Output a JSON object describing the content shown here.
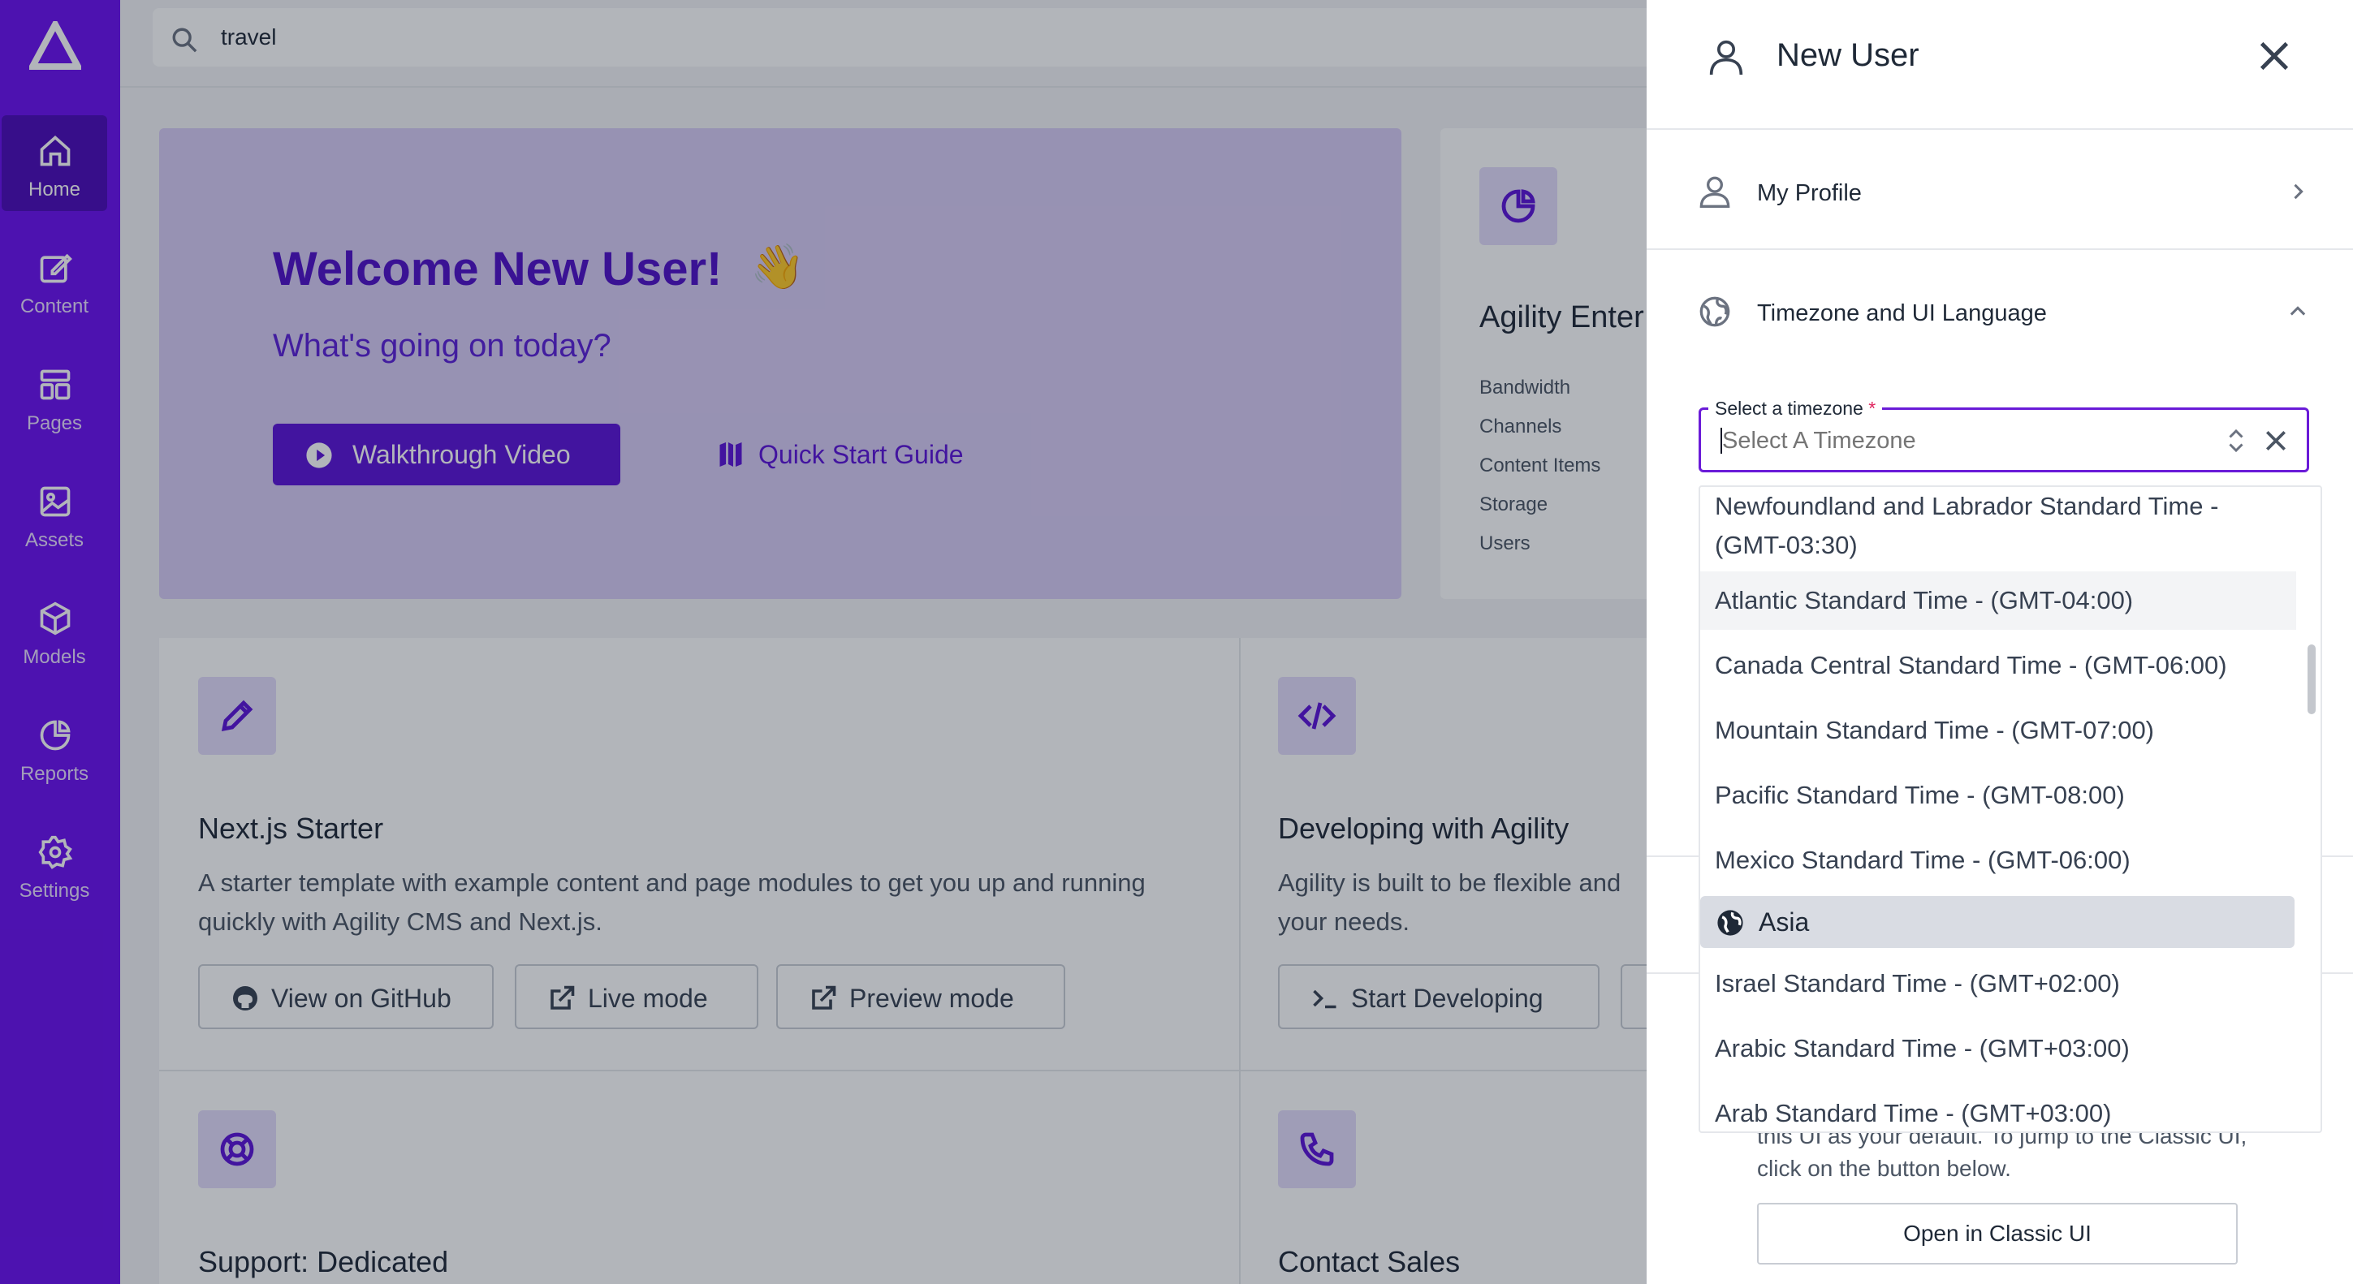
{
  "sidebar": {
    "items": [
      {
        "label": "Home",
        "icon": "home-icon",
        "active": true
      },
      {
        "label": "Content",
        "icon": "edit-icon"
      },
      {
        "label": "Pages",
        "icon": "pages-icon"
      },
      {
        "label": "Assets",
        "icon": "image-icon"
      },
      {
        "label": "Models",
        "icon": "cube-icon"
      },
      {
        "label": "Reports",
        "icon": "pie-chart-icon"
      },
      {
        "label": "Settings",
        "icon": "gear-icon"
      }
    ]
  },
  "search": {
    "value": "travel"
  },
  "hero": {
    "title": "Welcome New User!",
    "wave": "👋",
    "subtitle": "What's going on today?",
    "primary_button": "Walkthrough Video",
    "link_button": "Quick Start Guide"
  },
  "stats": {
    "title": "Agility Enter",
    "rows": [
      "Bandwidth",
      "Channels",
      "Content Items",
      "Storage",
      "Users"
    ]
  },
  "cards": [
    {
      "title": "Next.js Starter",
      "desc": "A starter template with example content and page modules to get you up and running quickly with Agility CMS and Next.js.",
      "buttons": [
        "View on GitHub",
        "Live mode",
        "Preview mode"
      ]
    },
    {
      "title": "Developing with Agility",
      "desc": "Agility is built to be flexible and your needs.",
      "buttons": [
        "Start Developing"
      ]
    },
    {
      "title": "Support: Dedicated"
    },
    {
      "title": "Contact Sales"
    }
  ],
  "drawer": {
    "title": "New User",
    "sections": {
      "profile": "My Profile",
      "timezone": "Timezone and UI Language"
    },
    "field": {
      "label": "Select a timezone",
      "required_mark": "*",
      "placeholder": "Select A Timezone"
    },
    "options_top": [
      "Newfoundland and Labrador Standard Time -",
      "(GMT-03:30)",
      "Atlantic Standard Time - (GMT-04:00)",
      "Canada Central Standard Time - (GMT-06:00)",
      "Mountain Standard Time - (GMT-07:00)",
      "Pacific Standard Time - (GMT-08:00)",
      "Mexico Standard Time - (GMT-06:00)"
    ],
    "group_label": "Asia",
    "options_bottom": [
      "Israel Standard Time - (GMT+02:00)",
      "Arabic Standard Time - (GMT+03:00)",
      "Arab Standard Time - (GMT+03:00)"
    ],
    "note": "this UI as your default. To jump to the Classic UI, click on the button below.",
    "classic_button": "Open in Classic UI"
  },
  "colors": {
    "brand": "#6a0ff0",
    "accent": "#5b12d8"
  }
}
